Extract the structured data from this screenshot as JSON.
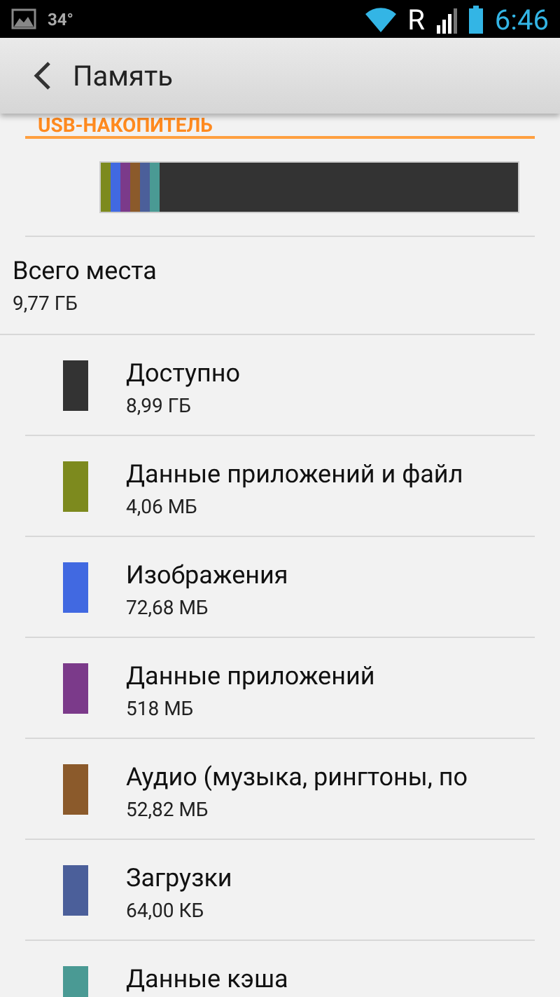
{
  "status_bar": {
    "temperature": "34°",
    "roaming": "R",
    "time": "6:46"
  },
  "action_bar": {
    "title": "Память"
  },
  "section": {
    "title": "USB-НАКОПИТЕЛЬ"
  },
  "total": {
    "label": "Всего места",
    "value": "9,77 ГБ"
  },
  "items": [
    {
      "kind": "free",
      "label": "Доступно",
      "size": "8,99 ГБ",
      "color": "#333333"
    },
    {
      "kind": "used",
      "label": "Данные приложений и файл",
      "size": "4,06 МБ",
      "color": "#7d8a1e"
    },
    {
      "kind": "used",
      "label": "Изображения",
      "size": "72,68 МБ",
      "color": "#4169e1"
    },
    {
      "kind": "used",
      "label": "Данные приложений",
      "size": "518 МБ",
      "color": "#7b3a8a"
    },
    {
      "kind": "used",
      "label": "Аудио (музыка, рингтоны, по",
      "size": "52,82 МБ",
      "color": "#8b5a2b"
    },
    {
      "kind": "used",
      "label": "Загрузки",
      "size": "64,00 КБ",
      "color": "#4b5f9a"
    },
    {
      "kind": "used",
      "label": "Данные кэша",
      "color": "#4a9a94"
    }
  ]
}
